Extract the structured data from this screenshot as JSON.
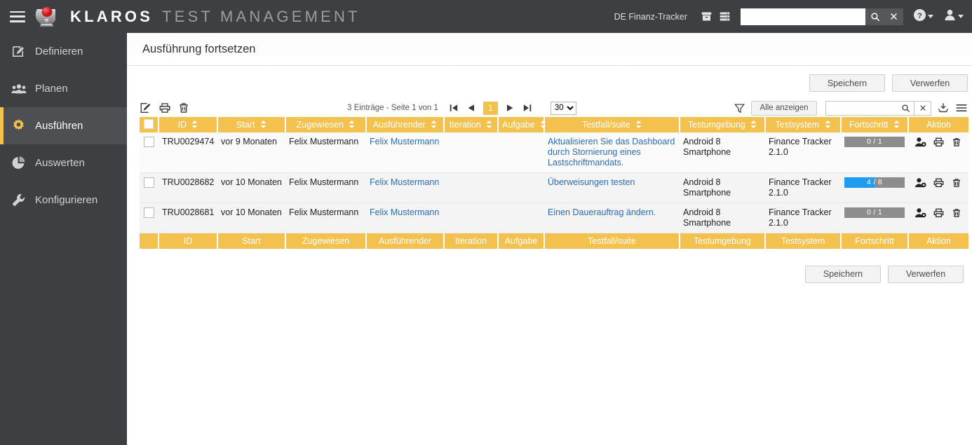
{
  "header": {
    "menu_icon": "hamburger-icon",
    "logo_icon": "klaros-logo-icon",
    "brand_primary": "KLAROS",
    "brand_secondary": "TEST MANAGEMENT",
    "project_name": "DE Finanz-Tracker",
    "archive_icon": "archive-box-icon",
    "server_icon": "server-stack-icon",
    "search_value": "",
    "search_placeholder": "",
    "search_icon": "search-icon",
    "clear_icon": "close-icon",
    "help_icon": "help-circle-icon",
    "help_caret_icon": "chevron-down-icon",
    "user_icon": "user-icon",
    "user_caret_icon": "chevron-down-icon"
  },
  "sidebar": {
    "items": [
      {
        "label": "Definieren",
        "icon": "edit-document-icon",
        "active": false
      },
      {
        "label": "Planen",
        "icon": "users-group-icon",
        "active": false
      },
      {
        "label": "Ausführen",
        "icon": "gear-icon",
        "active": true
      },
      {
        "label": "Auswerten",
        "icon": "pie-chart-icon",
        "active": false
      },
      {
        "label": "Konfigurieren",
        "icon": "wrench-icon",
        "active": false
      }
    ]
  },
  "main": {
    "page_title": "Ausführung fortsetzen",
    "buttons_top": {
      "save": "Speichern",
      "discard": "Verwerfen"
    },
    "buttons_bottom": {
      "save": "Speichern",
      "discard": "Verwerfen"
    }
  },
  "toolbar": {
    "edit_icon": "edit-square-icon",
    "print_icon": "printer-icon",
    "delete_icon": "trash-icon",
    "page_info": "3 Einträge - Seite 1 von 1",
    "first_icon": "first-page-icon",
    "prev_icon": "previous-page-icon",
    "current_page": "1",
    "next_icon": "next-page-icon",
    "last_icon": "last-page-icon",
    "page_size": "30",
    "page_size_options": [
      "30"
    ],
    "filter_icon": "funnel-filter-icon",
    "show_all_label": "Alle anzeigen",
    "filter_value": "",
    "filter_search_icon": "search-icon",
    "filter_clear_icon": "close-icon",
    "export_icon": "download-tray-icon",
    "columns_icon": "hamburger-menu-icon"
  },
  "table": {
    "select_all_icon": "checkbox-unchecked-icon",
    "sort_icon": "sort-updown-icon",
    "columns": [
      {
        "key": "check",
        "label": "",
        "sortable": false
      },
      {
        "key": "id",
        "label": "ID",
        "sortable": true
      },
      {
        "key": "start",
        "label": "Start",
        "sortable": true
      },
      {
        "key": "zug",
        "label": "Zugewiesen",
        "sortable": true
      },
      {
        "key": "ausf",
        "label": "Ausführender",
        "sortable": true
      },
      {
        "key": "iter",
        "label": "Iteration",
        "sortable": true
      },
      {
        "key": "aufg",
        "label": "Aufgabe",
        "sortable": true
      },
      {
        "key": "case",
        "label": "Testfall/suite",
        "sortable": true
      },
      {
        "key": "env",
        "label": "Testumgebung",
        "sortable": true
      },
      {
        "key": "sys",
        "label": "Testsystem",
        "sortable": true
      },
      {
        "key": "prog",
        "label": "Fortschritt",
        "sortable": true
      },
      {
        "key": "act",
        "label": "Aktion",
        "sortable": false
      }
    ],
    "rows": [
      {
        "id": "TRU0029474",
        "start": "vor 9 Monaten",
        "assigned": "Felix Mustermann",
        "executor": "Felix Mustermann",
        "iteration": "",
        "task": "",
        "testcase": "Aktualisieren Sie das Dashboard durch Stornierung eines Lastschriftmandats.",
        "environment": "Android 8 Smartphone",
        "system": "Finance Tracker 2.1.0",
        "progress_label": "0 / 1",
        "progress_done": 0,
        "progress_total": 1,
        "actions": [
          "assign-user-icon",
          "printer-icon",
          "trash-icon"
        ]
      },
      {
        "id": "TRU0028682",
        "start": "vor 10 Monaten",
        "assigned": "Felix Mustermann",
        "executor": "Felix Mustermann",
        "iteration": "",
        "task": "",
        "testcase": "Überweisungen testen",
        "environment": "Android 8 Smartphone",
        "system": "Finance Tracker 2.1.0",
        "progress_label": "4 / 8",
        "progress_done": 4,
        "progress_total": 8,
        "actions": [
          "assign-user-icon",
          "printer-icon",
          "trash-icon"
        ]
      },
      {
        "id": "TRU0028681",
        "start": "vor 10 Monaten",
        "assigned": "Felix Mustermann",
        "executor": "Felix Mustermann",
        "iteration": "",
        "task": "",
        "testcase": "Einen Dauerauftrag ändern.",
        "environment": "Android 8 Smartphone",
        "system": "Finance Tracker 2.1.0",
        "progress_label": "0 / 1",
        "progress_done": 0,
        "progress_total": 1,
        "actions": [
          "assign-user-icon",
          "printer-icon",
          "trash-icon"
        ]
      }
    ]
  },
  "colors": {
    "accent_gold": "#f2c14e",
    "topbar_dark": "#3c4043",
    "sidebar_active": "#4c5053",
    "link_blue": "#2b6cb0",
    "progress_blue": "#1f9cf0",
    "progress_track": "#8d8d8d",
    "logo_red": "#d82c2c"
  }
}
